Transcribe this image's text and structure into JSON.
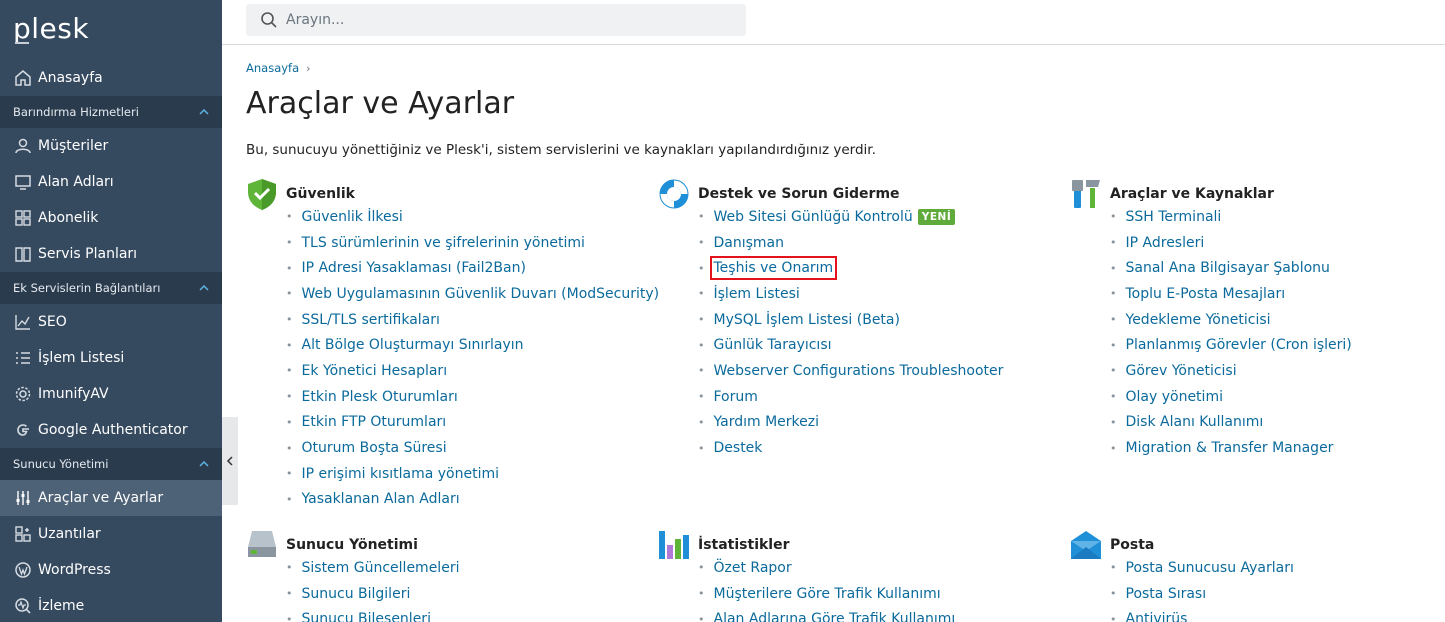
{
  "brand": {
    "logo": "plesk"
  },
  "search": {
    "placeholder": "Arayın..."
  },
  "sidebar": {
    "home": "Anasayfa",
    "sections": [
      {
        "title": "Barındırma Hizmetleri",
        "items": [
          "Müşteriler",
          "Alan Adları",
          "Abonelik",
          "Servis Planları"
        ]
      },
      {
        "title": "Ek Servislerin Bağlantıları",
        "items": [
          "SEO",
          "İşlem Listesi",
          "ImunifyAV",
          "Google Authenticator"
        ]
      },
      {
        "title": "Sunucu Yönetimi",
        "items": [
          "Araçlar ve Ayarlar",
          "Uzantılar",
          "WordPress",
          "İzleme"
        ]
      }
    ]
  },
  "breadcrumb": {
    "home": "Anasayfa"
  },
  "page": {
    "title": "Araçlar ve Ayarlar",
    "description": "Bu, sunucuyu yönettiğiniz ve Plesk'i, sistem servislerini ve kaynakları yapılandırdığınız yerdir."
  },
  "groups": {
    "security": {
      "title": "Güvenlik",
      "items": [
        "Güvenlik İlkesi",
        "TLS sürümlerinin ve şifrelerinin yönetimi",
        "IP Adresi Yasaklaması (Fail2Ban)",
        "Web Uygulamasının Güvenlik Duvarı (ModSecurity)",
        "SSL/TLS sertifikaları",
        "Alt Bölge Oluşturmayı Sınırlayın",
        "Ek Yönetici Hesapları",
        "Etkin Plesk Oturumları",
        "Etkin FTP Oturumları",
        "Oturum Boşta Süresi",
        "IP erişimi kısıtlama yönetimi",
        "Yasaklanan Alan Adları"
      ]
    },
    "support": {
      "title": "Destek ve Sorun Giderme",
      "badge": "YENİ",
      "items": [
        "Web Sitesi Günlüğü Kontrolü",
        "Danışman",
        "Teşhis ve Onarım",
        "İşlem Listesi",
        "MySQL İşlem Listesi (Beta)",
        "Günlük Tarayıcısı",
        "Webserver Configurations Troubleshooter",
        "Forum",
        "Yardım Merkezi",
        "Destek"
      ]
    },
    "tools": {
      "title": "Araçlar ve Kaynaklar",
      "items": [
        "SSH Terminali",
        "IP Adresleri",
        "Sanal Ana Bilgisayar Şablonu",
        "Toplu E-Posta Mesajları",
        "Yedekleme Yöneticisi",
        "Planlanmış Görevler (Cron işleri)",
        "Görev Yöneticisi",
        "Olay yönetimi",
        "Disk Alanı Kullanımı",
        "Migration & Transfer Manager"
      ]
    },
    "server": {
      "title": "Sunucu Yönetimi",
      "items": [
        "Sistem Güncellemeleri",
        "Sunucu Bilgileri",
        "Sunucu Bileşenleri"
      ]
    },
    "stats": {
      "title": "İstatistikler",
      "items": [
        "Özet Rapor",
        "Müşterilere Göre Trafik Kullanımı",
        "Alan Adlarına Göre Trafik Kullanımı"
      ]
    },
    "mail": {
      "title": "Posta",
      "items": [
        "Posta Sunucusu Ayarları",
        "Posta Sırası",
        "Antivirüs"
      ]
    }
  },
  "colors": {
    "sidebar": "#35495f",
    "sidebar_section": "#2a3b4e",
    "active": "#4e6277",
    "link": "#0b6a9c",
    "badge": "#5eaa3a",
    "highlight": "#e3121b"
  }
}
